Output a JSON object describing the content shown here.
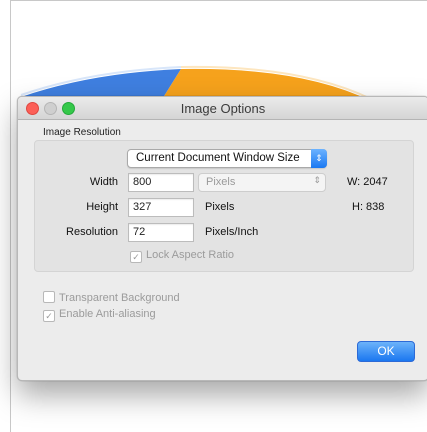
{
  "dialog": {
    "title": "Image Options",
    "group_title": "Image Resolution",
    "size_popup": {
      "selected": "Current Document Window Size"
    },
    "rows": {
      "width": {
        "label": "Width",
        "value": "800",
        "unit": "Pixels",
        "dimension": "W: 2047"
      },
      "height": {
        "label": "Height",
        "value": "327",
        "unit": "Pixels",
        "dimension": "H: 838"
      },
      "resolution": {
        "label": "Resolution",
        "value": "72",
        "unit": "Pixels/Inch"
      }
    },
    "lock_aspect_ratio": {
      "label": "Lock Aspect Ratio",
      "checked": true,
      "enabled": false
    },
    "transparent_background": {
      "label": "Transparent Background",
      "checked": false,
      "enabled": false
    },
    "anti_aliasing": {
      "label": "Enable Anti-aliasing",
      "checked": true,
      "enabled": false
    },
    "ok_label": "OK"
  },
  "colors": {
    "accent": "#1b77f0",
    "close": "#fc5f57",
    "zoom": "#35c84a",
    "pie_blue": "#3f7fe0",
    "pie_orange": "#f6a21c"
  }
}
